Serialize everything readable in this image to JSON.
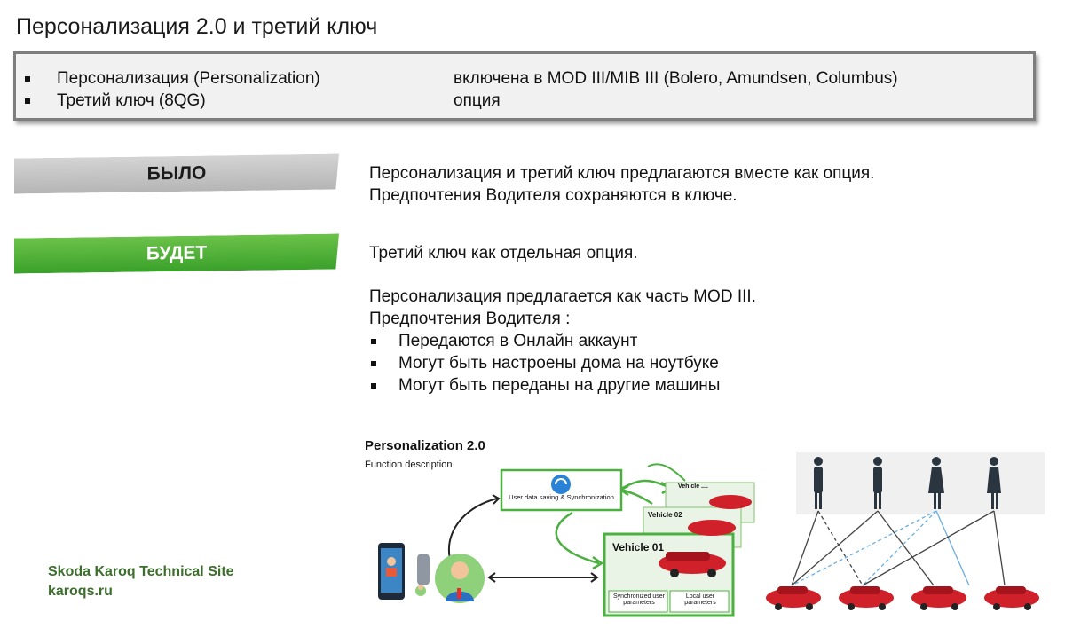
{
  "title": "Персонализация 2.0 и третий ключ",
  "info": [
    {
      "label": "Персонализация (Personalization)",
      "value": "включена в MOD III/MIB III (Bolero, Amundsen, Columbus)"
    },
    {
      "label": "Третий ключ (8QG)",
      "value": "опция"
    }
  ],
  "was": {
    "label": "БЫЛО",
    "lines": [
      "Персонализация и третий ключ предлагаются вместе как опция.",
      "Предпочтения Водителя сохраняются в ключе."
    ]
  },
  "will": {
    "label": "БУДЕТ",
    "line1": "Третий ключ как отдельная опция.",
    "line2": "Персонализация предлагается как часть MOD III.",
    "line3": "Предпочтения Водителя :",
    "bullets": [
      "Передаются в Онлайн аккаунт",
      "Могут быть настроены дома на ноутбуке",
      "Могут быть переданы на другие машины"
    ]
  },
  "figure": {
    "title": "Personalization 2.0",
    "subtitle": "Function description",
    "sync_label": "User data saving & Synchronization",
    "vehicle_back": "Vehicle ....",
    "vehicle_mid": "Vehicle 02",
    "vehicle_front": "Vehicle 01",
    "synced_label": "Synchronized user parameters",
    "local_label": "Local user parameters"
  },
  "watermark": {
    "line1": "Skoda Karoq Technical Site",
    "line2": "karoqs.ru"
  },
  "colors": {
    "green": "#4cb040",
    "gray_banner": "#c4c4c4",
    "car_red": "#d0202a",
    "person": "#2a3540"
  }
}
